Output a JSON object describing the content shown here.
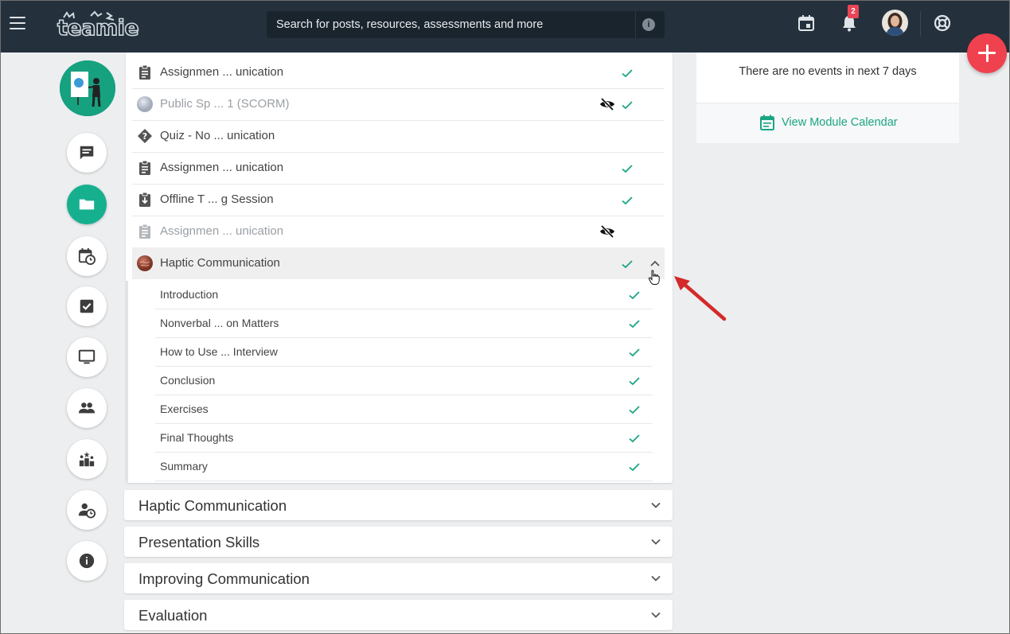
{
  "header": {
    "logo_text": "teamie",
    "search_placeholder": "Search for posts, resources, assessments and more",
    "notification_count": "2",
    "icons": [
      "menu-icon",
      "calendar-icon",
      "bell-icon",
      "avatar",
      "help-lifebuoy-icon"
    ]
  },
  "rail": {
    "items": [
      {
        "name": "posts",
        "icon": "chat-icon",
        "active": false
      },
      {
        "name": "materials",
        "icon": "folder-icon",
        "active": true
      },
      {
        "name": "schedule",
        "icon": "calendar-clock-icon",
        "active": false
      },
      {
        "name": "tasks",
        "icon": "checkbox-icon",
        "active": false
      },
      {
        "name": "present",
        "icon": "monitor-icon",
        "active": false
      },
      {
        "name": "members",
        "icon": "people-icon",
        "active": false
      },
      {
        "name": "leaderboard",
        "icon": "podium-stars-icon",
        "active": false
      },
      {
        "name": "attendance",
        "icon": "user-clock-icon",
        "active": false
      },
      {
        "name": "info",
        "icon": "info-icon",
        "active": false
      }
    ]
  },
  "module": {
    "items": [
      {
        "label": "Assignmen ... unication",
        "icon": "assignment-icon",
        "completed": true,
        "hidden": false,
        "muted": false
      },
      {
        "label": "Public Sp ... 1 (SCORM)",
        "icon": "scorm-thumbnail",
        "completed": true,
        "hidden": true,
        "muted": true
      },
      {
        "label": "Quiz - No ... unication",
        "icon": "quiz-icon",
        "completed": false,
        "hidden": false,
        "muted": false
      },
      {
        "label": "Assignmen ... unication",
        "icon": "assignment-icon",
        "completed": true,
        "hidden": false,
        "muted": false
      },
      {
        "label": "Offline T ... g Session",
        "icon": "offline-download-icon",
        "completed": true,
        "hidden": false,
        "muted": false
      },
      {
        "label": "Assignmen ... unication",
        "icon": "assignment-icon",
        "completed": false,
        "hidden": true,
        "muted": true
      },
      {
        "label": "Haptic Communication",
        "icon": "lesson-thumbnail",
        "completed": true,
        "hidden": false,
        "muted": false,
        "expanded": true
      }
    ],
    "lesson_pages": [
      {
        "label": "Introduction",
        "completed": true
      },
      {
        "label": "Nonverbal ... on Matters",
        "completed": true
      },
      {
        "label": "How to Use ... Interview",
        "completed": true
      },
      {
        "label": "Conclusion",
        "completed": true
      },
      {
        "label": "Exercises",
        "completed": true
      },
      {
        "label": "Final Thoughts",
        "completed": true
      },
      {
        "label": "Summary",
        "completed": true
      }
    ]
  },
  "sections": [
    {
      "title": "Haptic Communication"
    },
    {
      "title": "Presentation Skills"
    },
    {
      "title": "Improving Communication"
    },
    {
      "title": "Evaluation"
    }
  ],
  "events": {
    "empty_text": "There are no events in next 7 days",
    "calendar_link": "View Module Calendar"
  },
  "colors": {
    "topbar": "#24313d",
    "accent": "#17b08f",
    "check": "#1aa584",
    "fab": "#f0414f",
    "annotation_arrow": "#d42a2a"
  }
}
